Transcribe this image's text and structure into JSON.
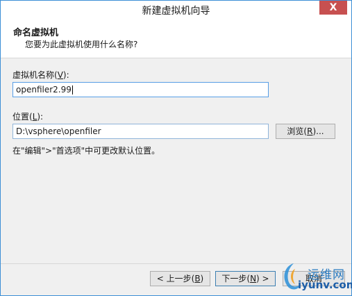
{
  "window": {
    "title": "新建虚拟机向导",
    "close_label": "X"
  },
  "header": {
    "title": "命名虚拟机",
    "subtitle": "您要为此虚拟机使用什么名称?"
  },
  "name_field": {
    "label_prefix": "虚拟机名称(",
    "label_key": "V",
    "label_suffix": "):",
    "value": "openfiler2.99"
  },
  "location_field": {
    "label_prefix": "位置(",
    "label_key": "L",
    "label_suffix": "):",
    "value": "D:\\vsphere\\openfiler",
    "browse_prefix": "浏览(",
    "browse_key": "R",
    "browse_suffix": ")..."
  },
  "hint": "在\"编辑\">\"首选项\"中可更改默认位置。",
  "footer": {
    "back_prefix": "< 上一步(",
    "back_key": "B",
    "back_suffix": ")",
    "next_prefix": "下一步(",
    "next_key": "N",
    "next_suffix": ") >",
    "cancel": "取消"
  },
  "watermark": {
    "cn": "运维网",
    "en": "iyunv.com"
  }
}
